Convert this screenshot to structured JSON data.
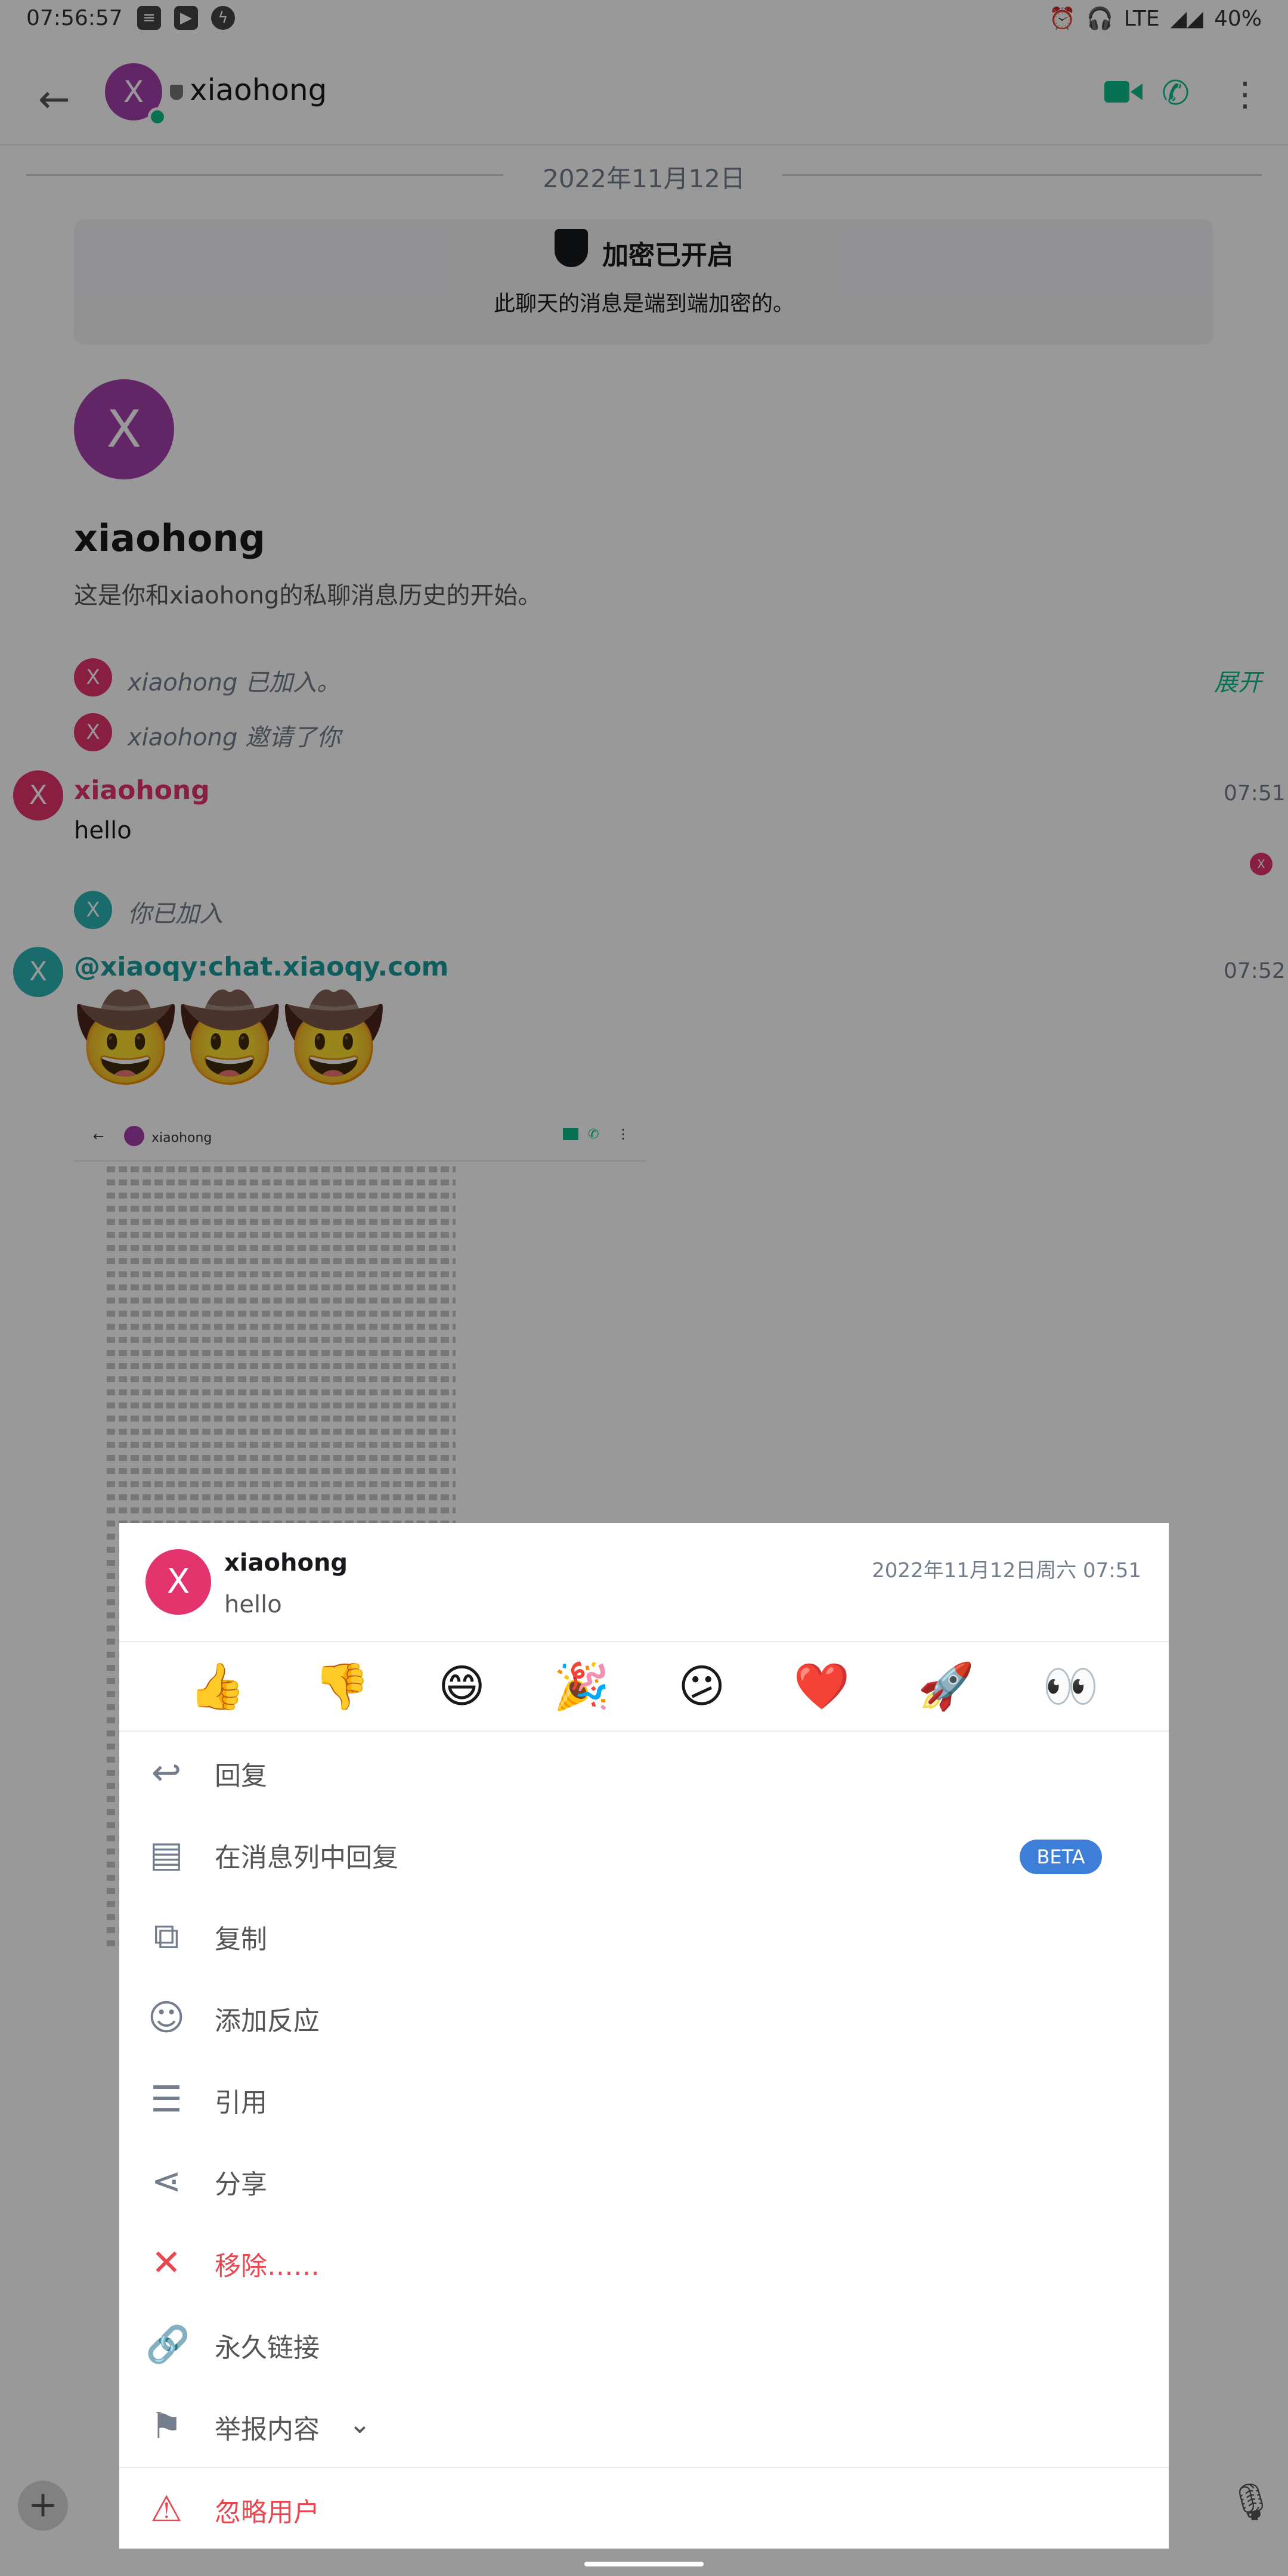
{
  "status_bar": {
    "time": "07:56:57",
    "network": "LTE",
    "battery": "40%",
    "icons": [
      "news-icon",
      "youtube-icon",
      "vpn-icon",
      "alarm-icon",
      "headphones-icon",
      "signal-icon",
      "battery-icon"
    ]
  },
  "header": {
    "contact_name": "xiaohong",
    "avatar_letter": "X",
    "accent": "#0dbd8b"
  },
  "timeline": {
    "date": "2022年11月12日",
    "encryption": {
      "title": "加密已开启",
      "subtitle": "此聊天的消息是端到端加密的。"
    },
    "intro_avatar_letter": "X",
    "intro_name": "xiaohong",
    "intro_text": "这是你和xiaohong的私聊消息历史的开始。",
    "events": [
      {
        "avatar": "X",
        "text": "xiaohong 已加入。"
      },
      {
        "avatar": "X",
        "text": "xiaohong 邀请了你"
      }
    ],
    "expand_label": "展开",
    "messages": [
      {
        "avatar": "X",
        "sender": "xiaohong",
        "time": "07:51",
        "body": "hello",
        "read_avatar": "X"
      },
      {
        "avatar": "X",
        "sender": "@xiaoqy:chat.xiaoqy.com",
        "time": "07:52",
        "body": "🤠🤠🤠"
      }
    ],
    "joined_event": {
      "avatar": "X",
      "text": "你已加入"
    },
    "thumbnail": {
      "header_name": "xiaohong"
    }
  },
  "sheet": {
    "sender": "xiaohong",
    "avatar_letter": "X",
    "timestamp": "2022年11月12日周六 07:51",
    "body": "hello",
    "reactions": [
      "👍",
      "👎",
      "😄",
      "🎉",
      "😕",
      "❤️",
      "🚀",
      "👀"
    ],
    "menu": [
      {
        "label": "回复",
        "icon": "reply-icon"
      },
      {
        "label": "在消息列中回复",
        "icon": "thread-icon",
        "badge": "BETA"
      },
      {
        "label": "复制",
        "icon": "copy-icon"
      },
      {
        "label": "添加反应",
        "icon": "add-reaction-icon"
      },
      {
        "label": "引用",
        "icon": "quote-icon"
      },
      {
        "label": "分享",
        "icon": "share-icon"
      },
      {
        "label": "移除……",
        "icon": "close-icon",
        "danger": true
      },
      {
        "label": "永久链接",
        "icon": "link-icon"
      },
      {
        "label": "举报内容",
        "icon": "flag-icon"
      },
      {
        "label": "忽略用户",
        "icon": "warning-icon",
        "danger": true
      }
    ]
  }
}
